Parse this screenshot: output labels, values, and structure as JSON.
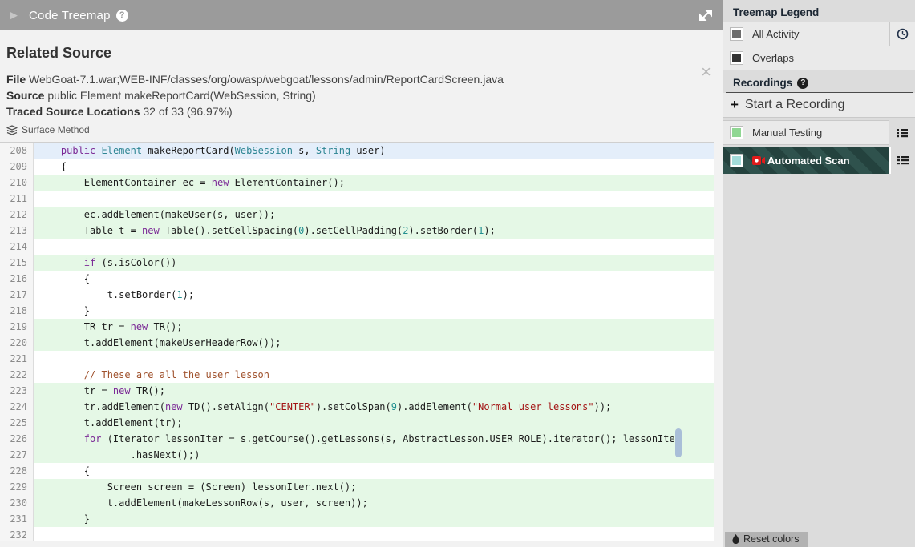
{
  "header": {
    "title": "Code Treemap",
    "help_icon": "?",
    "collapse_icon": "▶"
  },
  "panel": {
    "title": "Related Source",
    "close_icon": "×",
    "file_label": "File",
    "file_value": "WebGoat-7.1.war;WEB-INF/classes/org/owasp/webgoat/lessons/admin/ReportCardScreen.java",
    "source_label": "Source",
    "source_value": "public Element makeReportCard(WebSession, String)",
    "traced_label": "Traced Source Locations",
    "traced_value": "32 of 33 (96.97%)",
    "surface_method_label": "Surface Method"
  },
  "code": {
    "highlight_colors": {
      "selected_line": "#e4eefa",
      "covered_line": "#e5f8e6"
    },
    "lines": [
      {
        "n": 208,
        "h": "b",
        "s": [
          [
            "    ",
            ""
          ],
          [
            "public",
            "k"
          ],
          [
            " ",
            ""
          ],
          [
            "Element",
            "t"
          ],
          [
            " makeReportCard(",
            ""
          ],
          [
            "WebSession",
            "t"
          ],
          [
            " s, ",
            ""
          ],
          [
            "String",
            "t"
          ],
          [
            " user)",
            ""
          ]
        ]
      },
      {
        "n": 209,
        "h": "",
        "s": [
          [
            "    {",
            ""
          ]
        ]
      },
      {
        "n": 210,
        "h": "g",
        "s": [
          [
            "        ElementContainer ec = ",
            ""
          ],
          [
            "new",
            "k"
          ],
          [
            " ElementContainer();",
            ""
          ]
        ]
      },
      {
        "n": 211,
        "h": "",
        "s": [
          [
            "",
            ""
          ]
        ]
      },
      {
        "n": 212,
        "h": "g",
        "s": [
          [
            "        ec.addElement(makeUser(s, user));",
            ""
          ]
        ]
      },
      {
        "n": 213,
        "h": "g",
        "s": [
          [
            "        Table t = ",
            ""
          ],
          [
            "new",
            "k"
          ],
          [
            " Table().setCellSpacing(",
            ""
          ],
          [
            "0",
            "n"
          ],
          [
            ").setCellPadding(",
            ""
          ],
          [
            "2",
            "n"
          ],
          [
            ").setBorder(",
            ""
          ],
          [
            "1",
            "n"
          ],
          [
            ");",
            ""
          ]
        ]
      },
      {
        "n": 214,
        "h": "",
        "s": [
          [
            "",
            ""
          ]
        ]
      },
      {
        "n": 215,
        "h": "g",
        "s": [
          [
            "        ",
            ""
          ],
          [
            "if",
            "k"
          ],
          [
            " (s.isColor())",
            ""
          ]
        ]
      },
      {
        "n": 216,
        "h": "",
        "s": [
          [
            "        {",
            ""
          ]
        ]
      },
      {
        "n": 217,
        "h": "",
        "s": [
          [
            "            t.setBorder(",
            ""
          ],
          [
            "1",
            "n"
          ],
          [
            ");",
            ""
          ]
        ]
      },
      {
        "n": 218,
        "h": "",
        "s": [
          [
            "        }",
            ""
          ]
        ]
      },
      {
        "n": 219,
        "h": "g",
        "s": [
          [
            "        TR tr = ",
            ""
          ],
          [
            "new",
            "k"
          ],
          [
            " TR();",
            ""
          ]
        ]
      },
      {
        "n": 220,
        "h": "g",
        "s": [
          [
            "        t.addElement(makeUserHeaderRow());",
            ""
          ]
        ]
      },
      {
        "n": 221,
        "h": "",
        "s": [
          [
            "",
            ""
          ]
        ]
      },
      {
        "n": 222,
        "h": "",
        "s": [
          [
            "        ",
            ""
          ],
          [
            "// These are all the user lesson",
            "c"
          ]
        ]
      },
      {
        "n": 223,
        "h": "g",
        "s": [
          [
            "        tr = ",
            ""
          ],
          [
            "new",
            "k"
          ],
          [
            " TR();",
            ""
          ]
        ]
      },
      {
        "n": 224,
        "h": "g",
        "s": [
          [
            "        tr.addElement(",
            ""
          ],
          [
            "new",
            "k"
          ],
          [
            " TD().setAlign(",
            ""
          ],
          [
            "\"CENTER\"",
            "s"
          ],
          [
            ").setColSpan(",
            ""
          ],
          [
            "9",
            "n"
          ],
          [
            ").addElement(",
            ""
          ],
          [
            "\"Normal user lessons\"",
            "s"
          ],
          [
            "));",
            ""
          ]
        ]
      },
      {
        "n": 225,
        "h": "g",
        "s": [
          [
            "        t.addElement(tr);",
            ""
          ]
        ]
      },
      {
        "n": 226,
        "h": "g",
        "s": [
          [
            "        ",
            ""
          ],
          [
            "for",
            "k"
          ],
          [
            " (Iterator lessonIter = s.getCourse().getLessons(s, AbstractLesson.USER_ROLE).iterator(); lessonIter",
            ""
          ]
        ]
      },
      {
        "n": 227,
        "h": "g",
        "s": [
          [
            "                .hasNext();)",
            ""
          ]
        ]
      },
      {
        "n": 228,
        "h": "",
        "s": [
          [
            "        {",
            ""
          ]
        ]
      },
      {
        "n": 229,
        "h": "g",
        "s": [
          [
            "            Screen screen = (Screen) lessonIter.next();",
            ""
          ]
        ]
      },
      {
        "n": 230,
        "h": "g",
        "s": [
          [
            "            t.addElement(makeLessonRow(s, user, screen));",
            ""
          ]
        ]
      },
      {
        "n": 231,
        "h": "g",
        "s": [
          [
            "        }",
            ""
          ]
        ]
      },
      {
        "n": 232,
        "h": "",
        "s": [
          [
            "",
            ""
          ]
        ]
      }
    ]
  },
  "sidebar": {
    "legend_title": "Treemap Legend",
    "legend_items": [
      {
        "label": "All Activity",
        "swatch": "#6d6d6d",
        "has_clock": true
      },
      {
        "label": "Overlaps",
        "swatch": "#333333",
        "has_clock": false
      }
    ],
    "recordings_title": "Recordings",
    "recordings_help_icon": "?",
    "start_recording_label": "Start a Recording",
    "start_recording_plus": "+",
    "recordings": [
      {
        "label": "Manual Testing",
        "swatch": "#90d793",
        "selected": false,
        "recording": false
      },
      {
        "label": "Automated Scan",
        "swatch": "#a3dcda",
        "selected": true,
        "recording": true
      }
    ],
    "selected_row_colors": {
      "base": "#2f524d",
      "stripe": "#24423e"
    },
    "reset_button_label": "Reset colors"
  }
}
